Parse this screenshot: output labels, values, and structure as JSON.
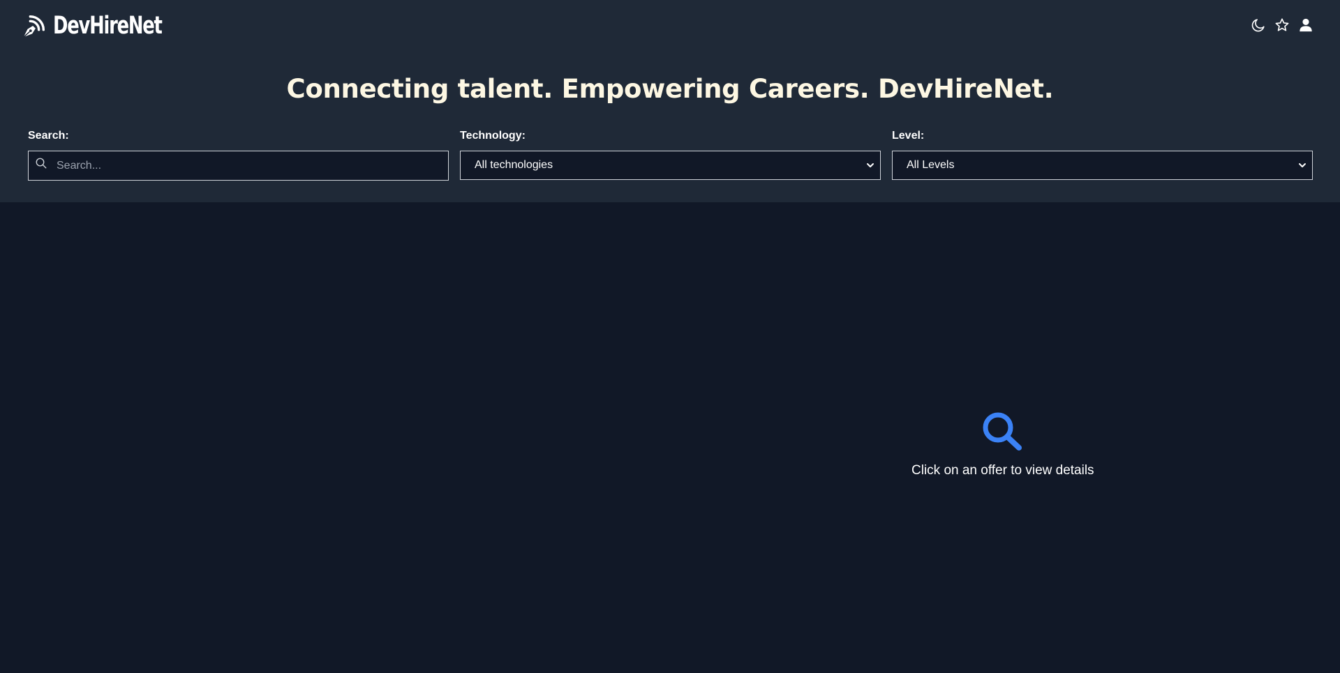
{
  "app": {
    "name": "DevHireNet",
    "logo_icon": "fountain-pen-icon"
  },
  "header": {
    "tagline": "Connecting talent. Empowering Careers. DevHireNet.",
    "actions": [
      {
        "icon": "moon-icon"
      },
      {
        "icon": "star-icon"
      },
      {
        "icon": "user-icon"
      }
    ]
  },
  "filters": {
    "search": {
      "label": "Search:",
      "placeholder": "Search...",
      "value": ""
    },
    "technology": {
      "label": "Technology:",
      "selected": "All technologies"
    },
    "level": {
      "label": "Level:",
      "selected": "All Levels"
    }
  },
  "details_panel": {
    "icon": "magnifier-icon",
    "message": "Click on an offer to view details"
  },
  "colors": {
    "header_bg": "#1f2937",
    "page_bg": "#111827",
    "accent": "#3b82f6",
    "tagline": "#fdf7e3"
  }
}
